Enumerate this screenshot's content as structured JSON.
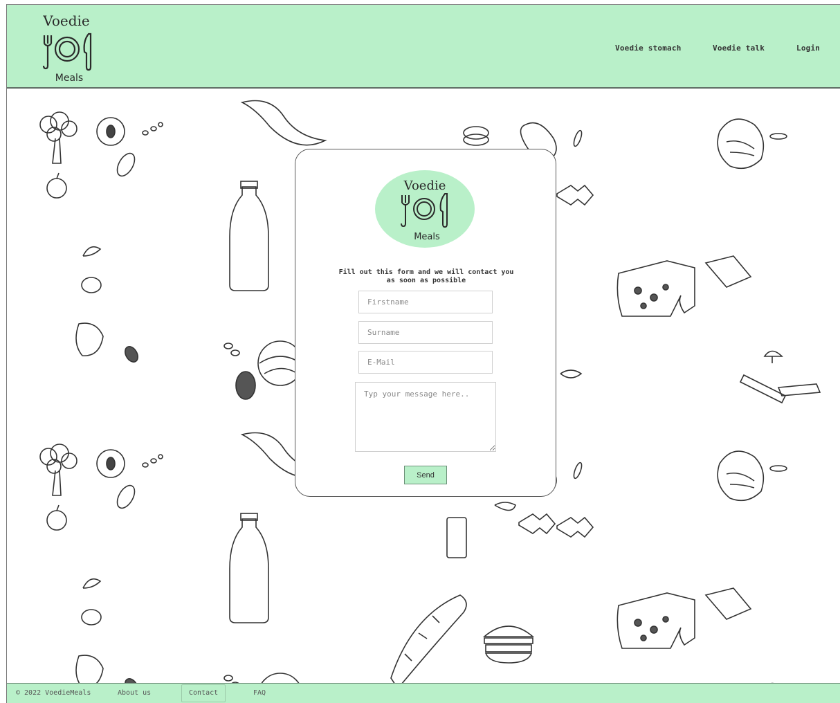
{
  "brand": {
    "logo_top": "Voedie",
    "logo_bottom": "Meals",
    "accent": "#b9f0c9",
    "logo_icon": "plate-fork-knife-icon"
  },
  "nav": {
    "items": [
      {
        "label": "Voedie stomach"
      },
      {
        "label": "Voedie talk"
      },
      {
        "label": "Login"
      }
    ]
  },
  "form": {
    "intro_line1": "Fill out this form and we will contact you",
    "intro_line2": "as soon as possible",
    "firstname_placeholder": "Firstname",
    "surname_placeholder": "Surname",
    "email_placeholder": "E-Mail",
    "message_placeholder": "Typ your message here..",
    "send_label": "Send"
  },
  "footer": {
    "copyright": "© 2022 VoedieMeals",
    "links": [
      {
        "label": "About us"
      },
      {
        "label": "Contact"
      },
      {
        "label": "FAQ"
      }
    ],
    "active": "Contact"
  },
  "background": {
    "pattern": "hand-drawn-food-sketch-pattern"
  }
}
